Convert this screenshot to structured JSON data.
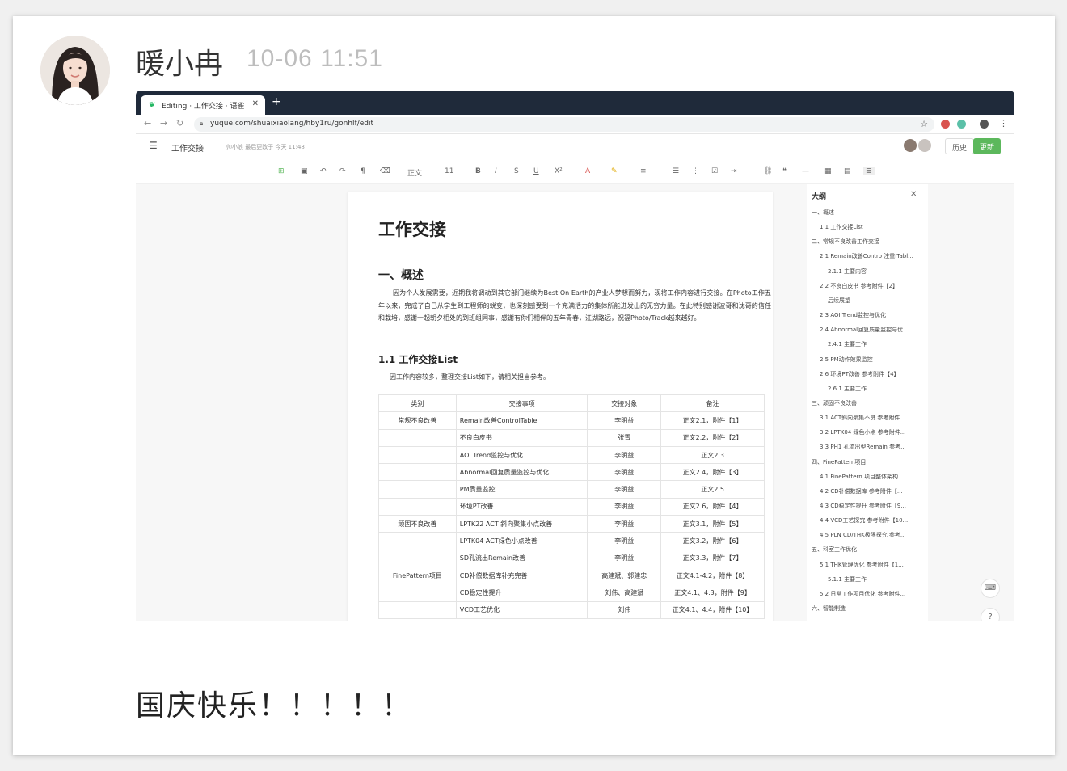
{
  "post": {
    "author": "暖小冉",
    "time": "10-06 11:51",
    "caption": "国庆快乐！！！！！"
  },
  "browser": {
    "tab_title": "Editing · 工作交接 · 语雀",
    "url": "yuque.com/shuaixiaolang/hby1ru/gonhlf/edit"
  },
  "editor": {
    "doc_name": "工作交接",
    "meta": "帅小浪 最后更改于 今天 11:48",
    "history_label": "历史",
    "update_label": "更新",
    "toolbar": {
      "style": "正文",
      "size": "11"
    }
  },
  "doc": {
    "title": "工作交接",
    "section1": "一、概述",
    "paragraph": "因为个人发展需要，近期我将调动到其它部门继续为Best On Earth的产业人梦想而努力，现将工作内容进行交接。在Photo工作五年以来，完成了自己从学生到工程师的蜕变，也深刻感受到一个充满活力的集体所能迸发出的无穷力量。在此特别感谢波哥和沈哥的信任和栽培，感谢一起朝夕相处的到班组同事，感谢有你们相伴的五年青春，江湖路远，祝福Photo/Track越来越好。",
    "section2": "1.1 工作交接List",
    "intro": "因工作内容较多，整理交接List如下，请相关担当参考。",
    "table": {
      "headers": [
        "类别",
        "交接事项",
        "交接对象",
        "备注"
      ],
      "rows": [
        [
          "常规不良改善",
          "Remain改善ControlTable",
          "李明益",
          "正文2.1，附件【1】"
        ],
        [
          "",
          "不良白皮书",
          "张雪",
          "正文2.2，附件【2】"
        ],
        [
          "",
          "AOI Trend监控与优化",
          "李明益",
          "正文2.3"
        ],
        [
          "",
          "Abnormal回复质量监控与优化",
          "李明益",
          "正文2.4，附件【3】"
        ],
        [
          "",
          "PM质量监控",
          "李明益",
          "正文2.5"
        ],
        [
          "",
          "环境PT改善",
          "李明益",
          "正文2.6，附件【4】"
        ],
        [
          "顽固不良改善",
          "LPTK22 ACT 斜向聚集小点改善",
          "李明益",
          "正文3.1，附件【5】"
        ],
        [
          "",
          "LPTK04 ACT绿色小点改善",
          "李明益",
          "正文3.2，附件【6】"
        ],
        [
          "",
          "SD孔流出Remain改善",
          "李明益",
          "正文3.3，附件【7】"
        ],
        [
          "FinePattern项目",
          "CD补偿数据库补充完善",
          "高建斌、郭建忠",
          "正文4.1-4.2，附件【8】"
        ],
        [
          "",
          "CD稳定性提升",
          "刘伟、高建斌",
          "正文4.1、4.3，附件【9】"
        ],
        [
          "",
          "VCD工艺优化",
          "刘伟",
          "正文4.1、4.4，附件【10】"
        ]
      ]
    }
  },
  "outline": {
    "title": "大纲",
    "items": [
      "一、概述",
      "1.1 工作交接List",
      "二、常规不良改善工作交接",
      "2.1 Remain改善Contro 注重ITabl...",
      "2.1.1 主要内容",
      "2.2 不良白皮书 参考附件【2】",
      "后续展望",
      "2.3 AOI Trend监控与优化",
      "2.4 Abnormal回复质量监控与优...",
      "2.4.1 主要工作",
      "2.5 PM动作效果监控",
      "2.6 环境PT改善 参考附件【4】",
      "2.6.1 主要工作",
      "三、顽固不良改善",
      "3.1 ACT斜向聚集不良 参考附件...",
      "3.2 LPTK04 绿色小点 参考附件...",
      "3.3 PH1 孔流出型Remain 参考...",
      "四、FinePattern项目",
      "4.1 FinePattern 项目整体架构",
      "4.2 CD补偿数据库 参考附件【...",
      "4.3 CD稳定性提升 参考附件【9...",
      "4.4 VCD工艺探究 参考附件【10...",
      "4.5 PLN CD/THK极限探究 参考...",
      "五、科室工作优化",
      "5.1 THK管理优化 参考附件【1...",
      "5.1.1 主要工作",
      "5.2 日常工作项目优化 参考附件...",
      "六、智能制造"
    ]
  },
  "icons": {
    "help": "?",
    "keyboard": "⌨"
  }
}
